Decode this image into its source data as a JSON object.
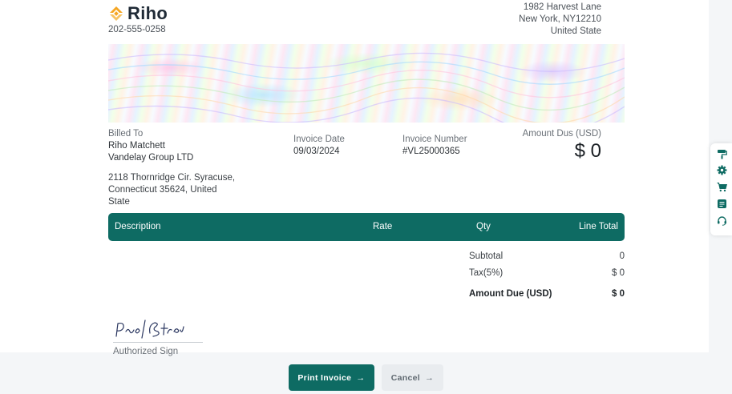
{
  "brand": {
    "name": "Riho",
    "phone": "202-555-0258"
  },
  "company_address": [
    "1982 Harvest Lane",
    "New York, NY12210",
    "United State"
  ],
  "billed_to": {
    "label": "Billed To",
    "name": "Riho Matchett",
    "company": "Vandelay Group LTD",
    "address": "2118 Thornridge Cir. Syracuse, Connecticut 35624, United State"
  },
  "invoice_date": {
    "label": "Invoice Date",
    "value": "09/03/2024"
  },
  "invoice_number": {
    "label": "Invoice Number",
    "value": "#VL25000365"
  },
  "amount_due": {
    "label": "Amount Dus (USD)",
    "value": "$ 0"
  },
  "table": {
    "headers": [
      "Description",
      "Rate",
      "Qty",
      "Line Total"
    ]
  },
  "totals": {
    "subtotal_label": "Subtotal",
    "subtotal_value": "0",
    "tax_label": "Tax(5%)",
    "tax_value": "$ 0",
    "grand_label": "Amount Due (USD)",
    "grand_value": "$ 0"
  },
  "signature": {
    "label": "Authorized Sign"
  },
  "buttons": {
    "print": "Print Invoice",
    "cancel": "Cancel"
  },
  "side_icons": [
    "paint-roller-icon",
    "gear-icon",
    "cart-icon",
    "notepad-icon",
    "headset-icon"
  ],
  "colors": {
    "accent": "#0e6b63",
    "logo": "#f5a623",
    "side_icon": "#0e6b63"
  }
}
